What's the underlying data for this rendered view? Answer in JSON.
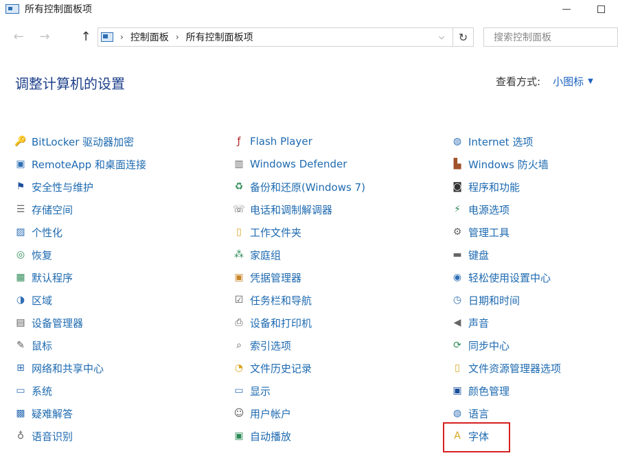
{
  "window": {
    "title": "所有控制面板项",
    "controls": {
      "minimize": "—",
      "maximize": "",
      "close": ""
    }
  },
  "nav": {
    "back_glyph": "←",
    "forward_glyph": "→",
    "up_glyph": "↑",
    "breadcrumbs": [
      "控制面板",
      "所有控制面板项"
    ],
    "crumb_separator": "›",
    "dropdown_glyph": "⌵",
    "refresh_glyph": "↻",
    "search_placeholder": "搜索控制面板"
  },
  "header": {
    "title": "调整计算机的设置",
    "view_by_label": "查看方式:",
    "view_by_value": "小图标",
    "view_by_arrow": "▼"
  },
  "items": {
    "col1": [
      {
        "label": "BitLocker 驱动器加密",
        "icon": "bitlocker-icon",
        "glyph": "🔑",
        "color": "#c8a030"
      },
      {
        "label": "RemoteApp 和桌面连接",
        "icon": "remoteapp-icon",
        "glyph": "▣",
        "color": "#2f6fb5"
      },
      {
        "label": "安全性与维护",
        "icon": "flag-icon",
        "glyph": "⚑",
        "color": "#1b4f9c"
      },
      {
        "label": "存储空间",
        "icon": "storage-icon",
        "glyph": "☰",
        "color": "#666666"
      },
      {
        "label": "个性化",
        "icon": "personalization-icon",
        "glyph": "▨",
        "color": "#2f6fb5"
      },
      {
        "label": "恢复",
        "icon": "recovery-icon",
        "glyph": "◎",
        "color": "#2e8b57"
      },
      {
        "label": "默认程序",
        "icon": "default-programs-icon",
        "glyph": "▦",
        "color": "#2e8b57"
      },
      {
        "label": "区域",
        "icon": "region-icon",
        "glyph": "◑",
        "color": "#2f6fb5"
      },
      {
        "label": "设备管理器",
        "icon": "device-manager-icon",
        "glyph": "▤",
        "color": "#555555"
      },
      {
        "label": "鼠标",
        "icon": "mouse-icon",
        "glyph": "✎",
        "color": "#555555"
      },
      {
        "label": "网络和共享中心",
        "icon": "network-icon",
        "glyph": "⊞",
        "color": "#2f6fb5"
      },
      {
        "label": "系统",
        "icon": "system-icon",
        "glyph": "▭",
        "color": "#2f6fb5"
      },
      {
        "label": "疑难解答",
        "icon": "troubleshoot-icon",
        "glyph": "▩",
        "color": "#2f6fb5"
      },
      {
        "label": "语音识别",
        "icon": "microphone-icon",
        "glyph": "♁",
        "color": "#666666"
      }
    ],
    "col2": [
      {
        "label": "Flash Player",
        "icon": "flash-player-icon",
        "glyph": "ƒ",
        "color": "#b01e1e"
      },
      {
        "label": "Windows Defender",
        "icon": "windows-defender-icon",
        "glyph": "▥",
        "color": "#666666"
      },
      {
        "label": "备份和还原(Windows 7)",
        "icon": "backup-icon",
        "glyph": "♻",
        "color": "#2e8b57"
      },
      {
        "label": "电话和调制解调器",
        "icon": "phone-modem-icon",
        "glyph": "☏",
        "color": "#555555"
      },
      {
        "label": "工作文件夹",
        "icon": "work-folders-icon",
        "glyph": "▯",
        "color": "#d9a520"
      },
      {
        "label": "家庭组",
        "icon": "homegroup-icon",
        "glyph": "⁂",
        "color": "#2e8b57"
      },
      {
        "label": "凭据管理器",
        "icon": "credential-manager-icon",
        "glyph": "▣",
        "color": "#c8862b"
      },
      {
        "label": "任务栏和导航",
        "icon": "taskbar-icon",
        "glyph": "☑",
        "color": "#555555"
      },
      {
        "label": "设备和打印机",
        "icon": "printer-icon",
        "glyph": "⎙",
        "color": "#555555"
      },
      {
        "label": "索引选项",
        "icon": "indexing-icon",
        "glyph": "⌕",
        "color": "#555555"
      },
      {
        "label": "文件历史记录",
        "icon": "file-history-icon",
        "glyph": "◔",
        "color": "#d9a520"
      },
      {
        "label": "显示",
        "icon": "display-icon",
        "glyph": "▭",
        "color": "#2f6fb5"
      },
      {
        "label": "用户帐户",
        "icon": "user-accounts-icon",
        "glyph": "☺",
        "color": "#555555"
      },
      {
        "label": "自动播放",
        "icon": "autoplay-icon",
        "glyph": "▣",
        "color": "#2e8b57"
      }
    ],
    "col3": [
      {
        "label": "Internet 选项",
        "icon": "internet-options-icon",
        "glyph": "◍",
        "color": "#2f6fb5"
      },
      {
        "label": "Windows 防火墙",
        "icon": "firewall-icon",
        "glyph": "▙",
        "color": "#a0522d"
      },
      {
        "label": "程序和功能",
        "icon": "programs-features-icon",
        "glyph": "◙",
        "color": "#333333"
      },
      {
        "label": "电源选项",
        "icon": "power-icon",
        "glyph": "⚡",
        "color": "#2e8b57"
      },
      {
        "label": "管理工具",
        "icon": "admin-tools-icon",
        "glyph": "⚙",
        "color": "#666666"
      },
      {
        "label": "键盘",
        "icon": "keyboard-icon",
        "glyph": "▬",
        "color": "#666666"
      },
      {
        "label": "轻松使用设置中心",
        "icon": "ease-of-access-icon",
        "glyph": "◉",
        "color": "#2f6fb5"
      },
      {
        "label": "日期和时间",
        "icon": "clock-icon",
        "glyph": "◷",
        "color": "#2f6fb5"
      },
      {
        "label": "声音",
        "icon": "speaker-icon",
        "glyph": "◀",
        "color": "#666666"
      },
      {
        "label": "同步中心",
        "icon": "sync-icon",
        "glyph": "⟳",
        "color": "#2e8b57"
      },
      {
        "label": "文件资源管理器选项",
        "icon": "folder-options-icon",
        "glyph": "▯",
        "color": "#d9a520"
      },
      {
        "label": "颜色管理",
        "icon": "color-management-icon",
        "glyph": "▣",
        "color": "#1b4f9c"
      },
      {
        "label": "语言",
        "icon": "language-icon",
        "glyph": "◍",
        "color": "#2f6fb5"
      },
      {
        "label": "字体",
        "icon": "fonts-icon",
        "glyph": "A",
        "color": "#d9a520"
      }
    ]
  },
  "accent_color": "#1e6ab0",
  "highlight_color": "#d61f1f"
}
